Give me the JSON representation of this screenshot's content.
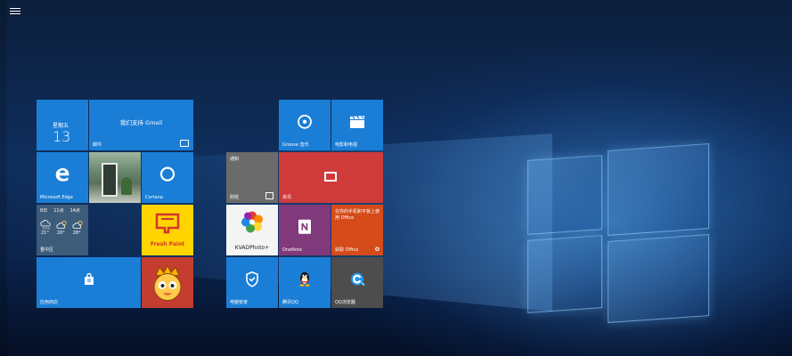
{
  "start_menu": {
    "tiles": {
      "calendar": {
        "weekday": "星期五",
        "day": "13"
      },
      "mail": {
        "tagline": "我们支持 Gmail",
        "label": "邮件"
      },
      "edge": {
        "label": "Microsoft Edge"
      },
      "photos": {
        "label": ""
      },
      "cortana": {
        "label": "Cortana"
      },
      "weather": {
        "days": [
          "8日",
          "11点",
          "14点"
        ],
        "temps": [
          "21°",
          "20°",
          "28°"
        ],
        "label": "晋中区"
      },
      "fresh_paint": {
        "label": "Fresh Paint"
      },
      "store": {
        "label": "应用商店"
      },
      "game": {
        "label": ""
      },
      "notifications": {
        "tagline": "通知",
        "label": "财经"
      },
      "news": {
        "label": "资讯"
      },
      "kvad": {
        "label": "KVADPhoto+"
      },
      "onenote": {
        "label": "OneNote"
      },
      "office": {
        "tagline": "在你的手机和平板上使用 Office",
        "label": "获取 Office"
      },
      "groove": {
        "label": "Groove 音乐"
      },
      "movies": {
        "label": "电影和电视"
      },
      "pcmanager": {
        "label": "电脑管家"
      },
      "qq": {
        "label": "腾讯QQ"
      },
      "qqbrowser": {
        "label": "QQ浏览器"
      }
    }
  },
  "colors": {
    "tile_blue": "#1b7ed6",
    "tile_red": "#cf3a3a",
    "tile_purple": "#80397b",
    "tile_orange": "#d54b1a",
    "tile_gray": "#6b6b6b",
    "tile_dark": "#4d4d4d",
    "tile_yellow": "#ffd400"
  },
  "icons": {
    "menu": "hamburger-icon",
    "edge": "edge-icon",
    "cortana": "cortana-icon",
    "store": "store-icon",
    "groove": "groove-icon",
    "movies": "clapperboard-icon",
    "news": "newspaper-icon",
    "onenote": "onenote-icon",
    "pcmanager": "shield-icon",
    "qq": "penguin-icon",
    "qqbrowser": "browser-icon"
  }
}
